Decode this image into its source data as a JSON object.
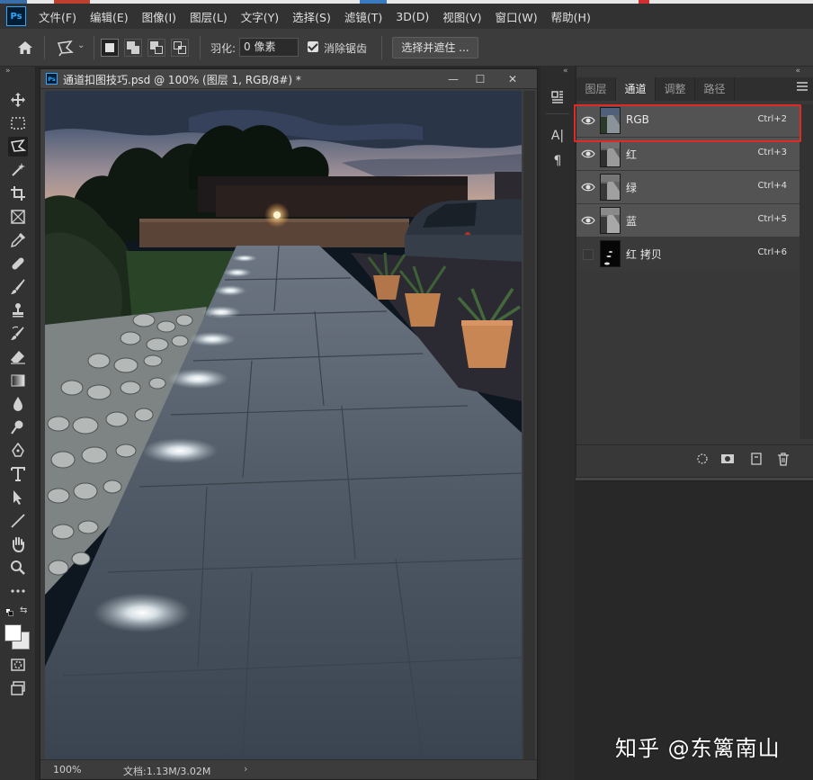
{
  "menu": [
    "文件(F)",
    "编辑(E)",
    "图像(I)",
    "图层(L)",
    "文字(Y)",
    "选择(S)",
    "滤镜(T)",
    "3D(D)",
    "视图(V)",
    "窗口(W)",
    "帮助(H)"
  ],
  "app_logo": "Ps",
  "options_bar": {
    "feather_label": "羽化:",
    "feather_value": "0 像素",
    "antialias_label": "消除锯齿",
    "antialias_checked": true,
    "select_mask_label": "选择并遮住 ..."
  },
  "document": {
    "logo": "Ps",
    "title": "通道扣图技巧.psd @ 100% (图层 1, RGB/8#) *",
    "zoom": "100%",
    "doc_info": "文档:1.13M/3.02M",
    "status_arrow": "›"
  },
  "window_controls": {
    "minimize": "—",
    "maximize": "☐",
    "close": "✕"
  },
  "dock_icons": [
    "paragraph-styles-icon",
    "character-icon",
    "paragraph-icon"
  ],
  "dock_labels": {
    "character": "A|",
    "paragraph": "¶"
  },
  "panel": {
    "tabs": [
      {
        "label": "图层",
        "active": false
      },
      {
        "label": "通道",
        "active": true
      },
      {
        "label": "调整",
        "active": false
      },
      {
        "label": "路径",
        "active": false
      }
    ],
    "channels": [
      {
        "name": "RGB",
        "shortcut": "Ctrl+2",
        "visible": true,
        "selected": true
      },
      {
        "name": "红",
        "shortcut": "Ctrl+3",
        "visible": true,
        "selected": false
      },
      {
        "name": "绿",
        "shortcut": "Ctrl+4",
        "visible": true,
        "selected": false
      },
      {
        "name": "蓝",
        "shortcut": "Ctrl+5",
        "visible": true,
        "selected": false
      },
      {
        "name": "红 拷贝",
        "shortcut": "Ctrl+6",
        "visible": false,
        "selected": false
      }
    ]
  },
  "watermark": "知乎 @东篱南山",
  "colors": {
    "highlight": "#e02a25",
    "ps_blue": "#31a8ff",
    "panel_bg": "#383838",
    "app_bg": "#282828"
  }
}
